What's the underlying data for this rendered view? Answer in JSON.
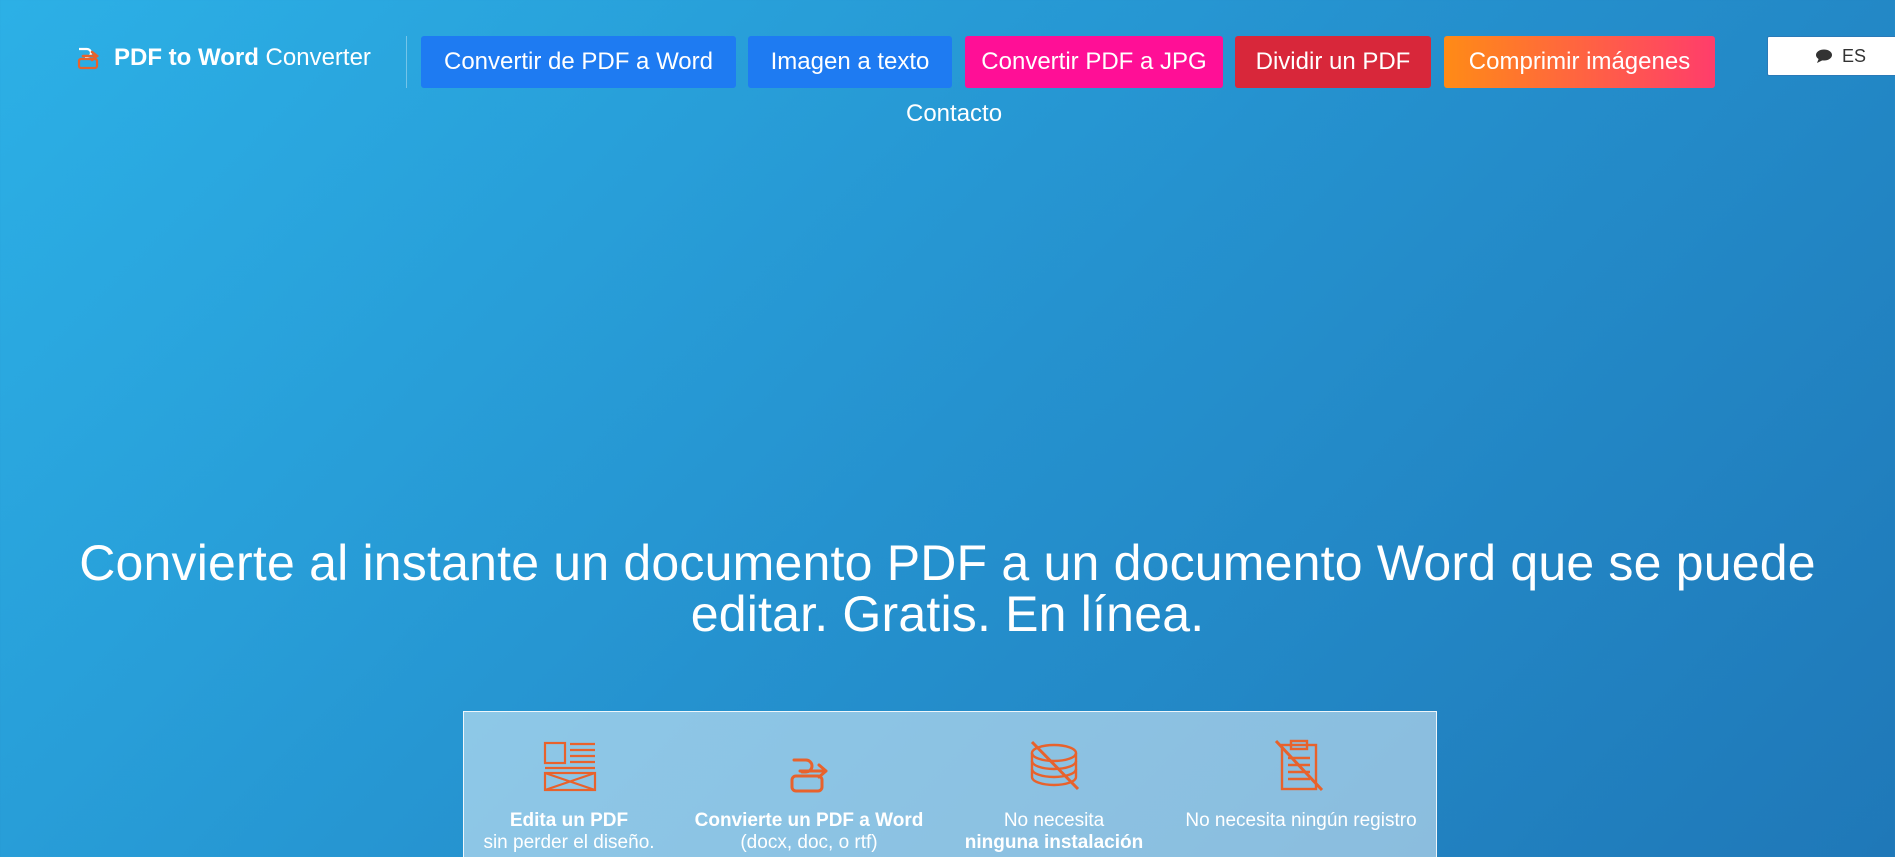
{
  "header": {
    "logo_bold": "PDF to Word",
    "logo_light": " Converter",
    "nav": [
      {
        "label": "Convertir de PDF a Word",
        "color": "#1e7bf2"
      },
      {
        "label": "Imagen a texto",
        "color": "#1e7bf2"
      },
      {
        "label": "Convertir PDF a JPG",
        "color": "#ff0f96"
      },
      {
        "label": "Dividir un PDF",
        "color": "#d8273a"
      },
      {
        "label": "Comprimir imágenes",
        "color": "#ff8b16"
      }
    ],
    "contact": "Contacto",
    "language": "ES"
  },
  "hero": {
    "title_line1": "Convierte al instante un documento PDF a un documento Word que se puede",
    "title_line2": "editar. Gratis. En línea."
  },
  "features": [
    {
      "icon": "layout-document-icon",
      "line1": "Edita un PDF",
      "line2": "sin perder el diseño."
    },
    {
      "icon": "convert-arrow-icon",
      "line1": "Convierte un PDF a Word",
      "line2": "(docx, doc, o rtf)"
    },
    {
      "icon": "no-database-icon",
      "line1": "No necesita",
      "line2": "ninguna instalación"
    },
    {
      "icon": "no-clipboard-icon",
      "line1": "No necesita ningún registro",
      "line2": ""
    }
  ],
  "colors": {
    "accent_orange": "#e8622c",
    "background_start": "#2cb0e6",
    "background_end": "#1f78b8"
  }
}
